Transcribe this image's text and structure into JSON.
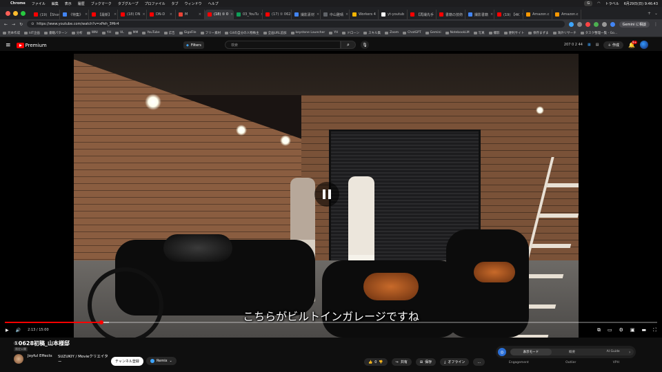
{
  "menubar": {
    "app": "Chrome",
    "items": [
      "ファイル",
      "編集",
      "表示",
      "履歴",
      "ブックマーク",
      "タブグループ",
      "プロファイル",
      "タブ",
      "ウィンドウ",
      "ヘルプ"
    ],
    "gemini_label": "G",
    "status": "トラベル",
    "datetime": "6月29日(日) 9:46:43"
  },
  "tabs": [
    {
      "label": "(19) 【Shorts】",
      "color": "#ff0000"
    },
    {
      "label": "《特集》",
      "color": "#4285f4"
    },
    {
      "label": "【最新】",
      "color": "#ff0000"
    },
    {
      "label": "(18) DN",
      "color": "#ff0000"
    },
    {
      "label": "DN-D",
      "color": "#ff0000"
    },
    {
      "label": "M",
      "color": "#ea4335"
    },
    {
      "label": "(18) ① 0",
      "color": "#ff0000",
      "active": true
    },
    {
      "label": "03_YouTu",
      "color": "#0f9d58"
    },
    {
      "label": "(17) ① 0628",
      "color": "#ff0000"
    },
    {
      "label": "撮影素材",
      "color": "#4285f4"
    },
    {
      "label": "中山雅晴",
      "color": "#5f6368"
    },
    {
      "label": "Workers 4",
      "color": "#f4b400"
    },
    {
      "label": "yt-youtub",
      "color": "#ffffff"
    },
    {
      "label": "【再撮先手",
      "color": "#ff0000"
    },
    {
      "label": "書籍の技術",
      "color": "#ff0000"
    },
    {
      "label": "撮影書籍",
      "color": "#4285f4"
    },
    {
      "label": "(19) 【4K",
      "color": "#ff0000"
    },
    {
      "label": "Amazon.c",
      "color": "#ff9900"
    },
    {
      "label": "Amazon.c",
      "color": "#ff9900"
    }
  ],
  "url": "https://www.youtube.com/watch?v=xPeh_3Mir4",
  "gemini_button": "Gemini に相談",
  "bookmarks": [
    "見本作成",
    "IdT企画",
    "書籍パターン",
    "分析",
    "WNI",
    "YH",
    "VL",
    "MM",
    "YouTube",
    "広告",
    "GigaFile",
    "フリー素材",
    "Gitの自分の人物株主",
    "全画URL追加",
    "keystone Launcher",
    "YH",
    "ドローン",
    "スキル集",
    "Zoom",
    "ChatGPT",
    "Gemini",
    "NotebookLM",
    "写真",
    "撮影",
    "便利サイト",
    "保存まずま",
    "海外リサーチ",
    "タスク整理一覧 - Go..."
  ],
  "youtube": {
    "brand": "Premium",
    "filters": "Filters",
    "search_placeholder": "検索",
    "header_stats": "207  0  2  44",
    "create": "作成",
    "notifications": "9+"
  },
  "video": {
    "subtitle": "こちらがビルトインガレージですね",
    "time_current": "2:13",
    "time_total": "15:00",
    "progress": 0.148,
    "buffered": 0.16
  },
  "info": {
    "title": "①0628初稿_山本様邸",
    "badge": "限定公開",
    "channel": "Joyful Effects",
    "channel_sub": "SUZUKIY / Movieクリエイター",
    "subscribe": "チャンネル登録",
    "remix": "Remix",
    "likes": "0",
    "share": "共有",
    "save": "保存",
    "offline": "オフライン",
    "ai_modes": [
      "表示モード",
      "概要",
      "AI Guide"
    ],
    "ai_labels": [
      "Engagement",
      "Outlier",
      "VPH"
    ]
  }
}
